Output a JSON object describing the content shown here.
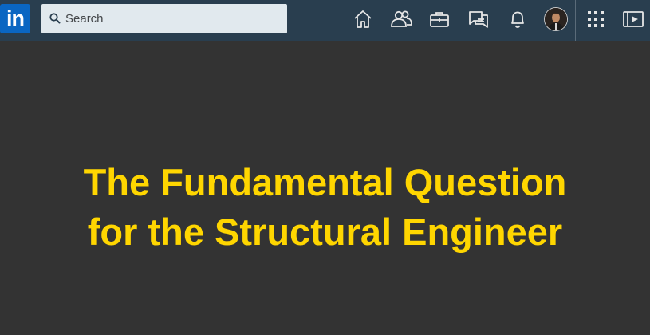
{
  "colors": {
    "topbar_bg": "#293e4f",
    "logo_bg": "#0a66c2",
    "search_bg": "#e1e9ee",
    "slide_bg": "#333333",
    "slide_title": "#ffd600"
  },
  "header": {
    "logo_text": "in",
    "search": {
      "placeholder": "Search",
      "icon": "search-icon"
    },
    "nav_icons": [
      "home-icon",
      "my-network-icon",
      "jobs-icon",
      "messaging-icon",
      "notifications-icon",
      "profile-avatar",
      "apps-grid-icon",
      "learning-icon"
    ]
  },
  "slide": {
    "title_line_1": "The Fundamental Question",
    "title_line_2": "for the Structural Engineer"
  }
}
